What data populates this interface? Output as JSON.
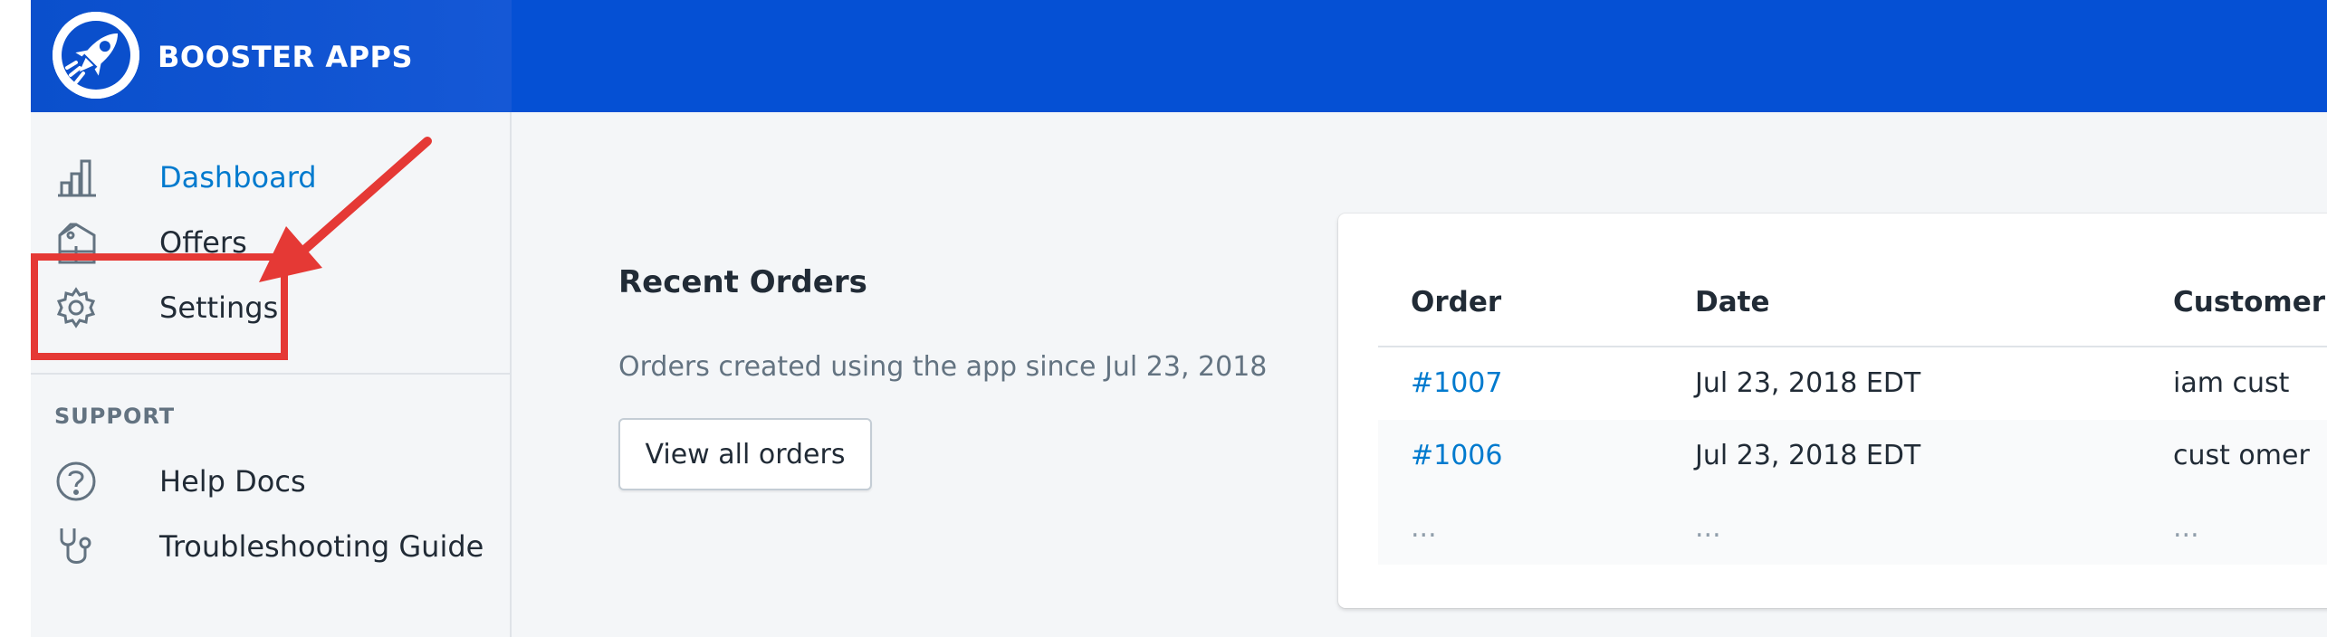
{
  "brand": {
    "name": "BOOSTER APPS",
    "logo_icon": "rocket-icon"
  },
  "sidebar": {
    "items": [
      {
        "label": "Dashboard",
        "icon": "bar-chart-icon",
        "active": true
      },
      {
        "label": "Offers",
        "icon": "tag-icon",
        "active": false
      },
      {
        "label": "Settings",
        "icon": "gear-icon",
        "active": false
      }
    ],
    "support_title": "SUPPORT",
    "support_items": [
      {
        "label": "Help Docs",
        "icon": "question-circle-icon"
      },
      {
        "label": "Troubleshooting Guide",
        "icon": "stethoscope-icon"
      }
    ]
  },
  "main": {
    "section_title": "Recent Orders",
    "section_subtitle": "Orders created using the app since Jul 23, 2018",
    "view_all_label": "View all orders"
  },
  "orders_table": {
    "headers": [
      "Order",
      "Date",
      "Customer"
    ],
    "rows": [
      {
        "order": "#1007",
        "date": "Jul 23, 2018 EDT",
        "customer": "iam cust"
      },
      {
        "order": "#1006",
        "date": "Jul 23, 2018 EDT",
        "customer": "cust omer"
      },
      {
        "order": "...",
        "date": "...",
        "customer": "..."
      }
    ]
  },
  "annotation": {
    "highlight_color": "#e53935",
    "target": "Settings"
  },
  "colors": {
    "header": "#0550d4",
    "link": "#007ace",
    "background": "#f4f6f8"
  }
}
